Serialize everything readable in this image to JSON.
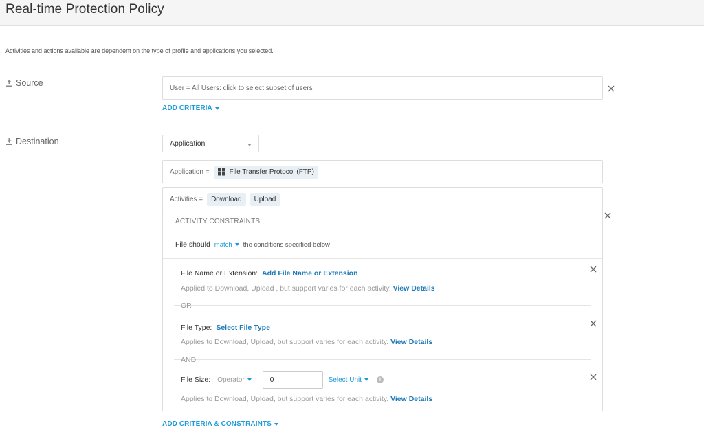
{
  "header": {
    "title": "Real-time Protection Policy"
  },
  "intro": "Activities and actions available are dependent on the type of profile and applications you selected.",
  "source": {
    "label": "Source",
    "icon": "upload-icon",
    "criteria_value": "User = All Users: click to select subset of users",
    "add_criteria": "ADD CRITERIA"
  },
  "destination": {
    "label": "Destination",
    "icon": "download-icon",
    "type_select": "Application",
    "application_prefix": "Application =",
    "application_chip": "File Transfer Protocol (FTP)",
    "activities_prefix": "Activities =",
    "activities": [
      "Download",
      "Upload"
    ]
  },
  "constraints": {
    "title": "ACTIVITY CONSTRAINTS",
    "file_should": "File should",
    "match": "match",
    "conditions_text": "the conditions specified below",
    "file_name": {
      "label": "File Name or Extension:",
      "action": "Add File Name or Extension",
      "desc": "Applied to Download, Upload , but support varies for each activity.",
      "view": "View Details"
    },
    "or_label": "OR",
    "file_type": {
      "label": "File Type:",
      "action": "Select File Type",
      "desc": "Applies to Download, Upload, but support varies for each activity.",
      "view": "View Details"
    },
    "and_label": "AND",
    "file_size": {
      "label": "File Size:",
      "operator": "Operator",
      "value": "0",
      "unit": "Select Unit",
      "desc": "Applies to Download, Upload, but support varies for each activity.",
      "view": "View Details"
    }
  },
  "add_criteria_constraints": "ADD CRITERIA & CONSTRAINTS",
  "colors": {
    "link": "#1e9bd7",
    "link_dark": "#1e7ab8",
    "chip_bg": "#e8f0f5"
  }
}
